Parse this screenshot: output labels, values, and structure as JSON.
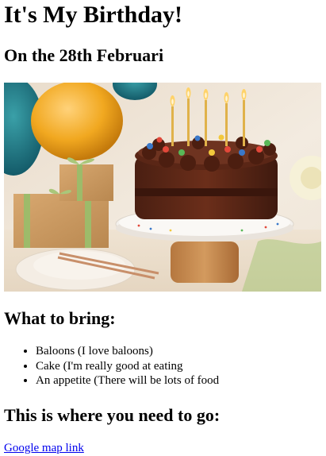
{
  "header": {
    "title": "It's My Birthday!",
    "subtitle": "On the 28th Februari"
  },
  "photo": {
    "subject": "birthday-cake-photo"
  },
  "bring": {
    "heading": "What to bring:",
    "items": [
      "Baloons (I love baloons)",
      "Cake (I'm really good at eating",
      "An appetite (There will be lots of food"
    ]
  },
  "directions": {
    "heading": "This is where you need to go:",
    "link_label": "Google map link"
  },
  "colors": {
    "link": "#0000ee",
    "text": "#000000",
    "background": "#ffffff"
  }
}
